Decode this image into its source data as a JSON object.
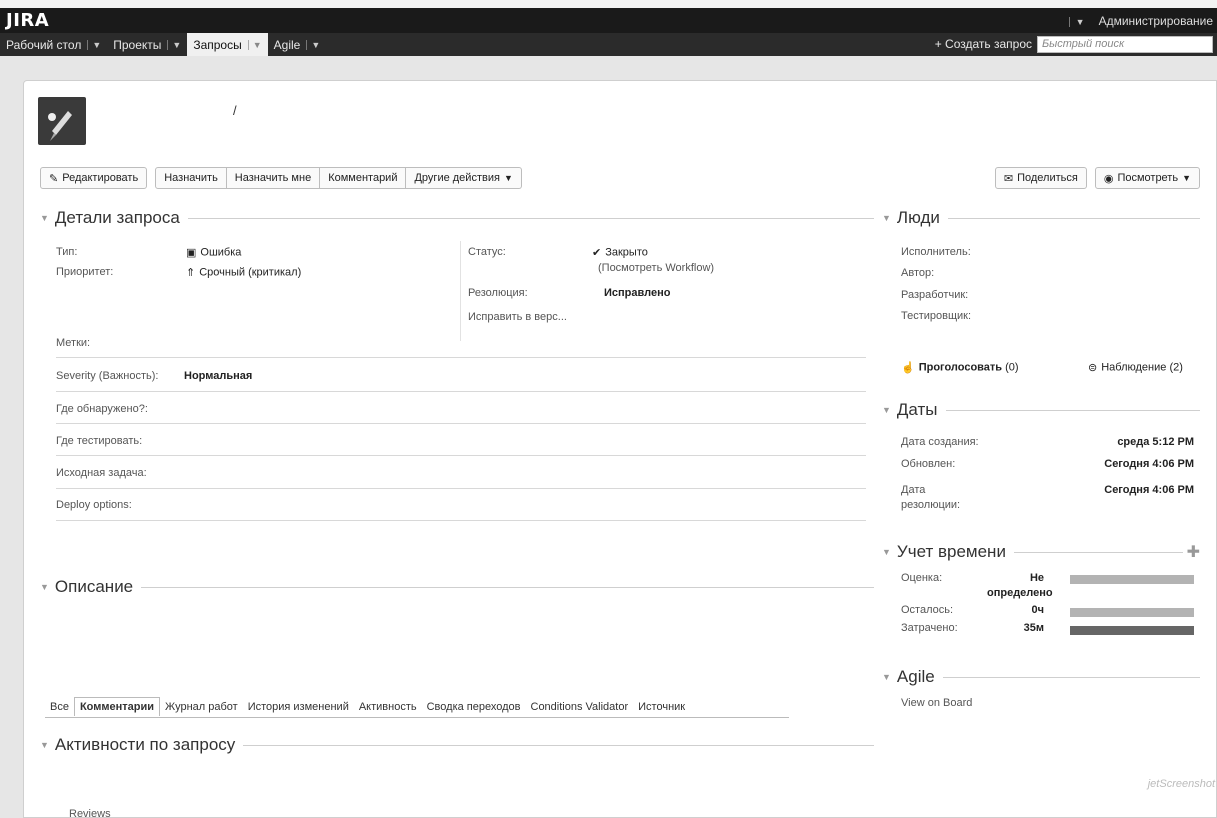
{
  "header": {
    "logo": "JIRA",
    "admin_label": "Администрирование",
    "nav": [
      {
        "label": "Рабочий стол"
      },
      {
        "label": "Проекты"
      },
      {
        "label": "Запросы"
      },
      {
        "label": "Agile"
      }
    ],
    "create_label": "+ Создать запрос",
    "search_placeholder": "Быстрый поиск"
  },
  "issue": {
    "title_sep": "/"
  },
  "toolbar": {
    "edit": "Редактировать",
    "assign": "Назначить",
    "assign_me": "Назначить мне",
    "comment": "Комментарий",
    "more": "Другие действия",
    "share": "Поделиться",
    "watch": "Посмотреть"
  },
  "details": {
    "title": "Детали запроса",
    "type_label": "Тип:",
    "type_value": "Ошибка",
    "priority_label": "Приоритет:",
    "priority_value": "Срочный (критикал)",
    "status_label": "Статус:",
    "status_value": "Закрыто",
    "workflow_link": "(Посмотреть Workflow)",
    "resolution_label": "Резолюция:",
    "resolution_value": "Исправлено",
    "fixver_label": "Исправить в верс...",
    "labels_label": "Метки:",
    "severity_label": "Severity (Важность):",
    "severity_value": "Нормальная",
    "found_label": "Где обнаружено?:",
    "test_label": "Где тестировать:",
    "source_label": "Исходная задача:",
    "deploy_label": "Deploy options:"
  },
  "description": {
    "title": "Описание"
  },
  "activity": {
    "title": "Активности по запросу",
    "tabs": [
      "Все",
      "Комментарии",
      "Журнал работ",
      "История изменений",
      "Активность",
      "Сводка переходов",
      "Conditions Validator",
      "Источник"
    ],
    "reviews": "Reviews"
  },
  "people": {
    "title": "Люди",
    "assignee": "Исполнитель:",
    "author": "Автор:",
    "developer": "Разработчик:",
    "tester": "Тестировщик:",
    "vote_label": "Проголосовать",
    "vote_count": "(0)",
    "watch_label": "Наблюдение (2)"
  },
  "dates": {
    "title": "Даты",
    "created_label": "Дата создания:",
    "created_value": "среда 5:12 PM",
    "updated_label": "Обновлен:",
    "updated_value": "Сегодня 4:06 PM",
    "resolved_label_1": "Дата",
    "resolved_label_2": "резолюции:",
    "resolved_value": "Сегодня 4:06 PM"
  },
  "time": {
    "title": "Учет времени",
    "estimate_label": "Оценка:",
    "estimate_value_1": "Не",
    "estimate_value_2": "определено",
    "remaining_label": "Осталось:",
    "remaining_value": "0ч",
    "logged_label": "Затрачено:",
    "logged_value": "35м",
    "estimate_fill": 1.0,
    "remaining_fill": 1.0,
    "logged_fill": 1.0,
    "color_light": "#b3b3b3",
    "color_dark": "#666666"
  },
  "agile": {
    "title": "Agile",
    "link": "View on Board"
  },
  "watermark": "jetScreenshot"
}
